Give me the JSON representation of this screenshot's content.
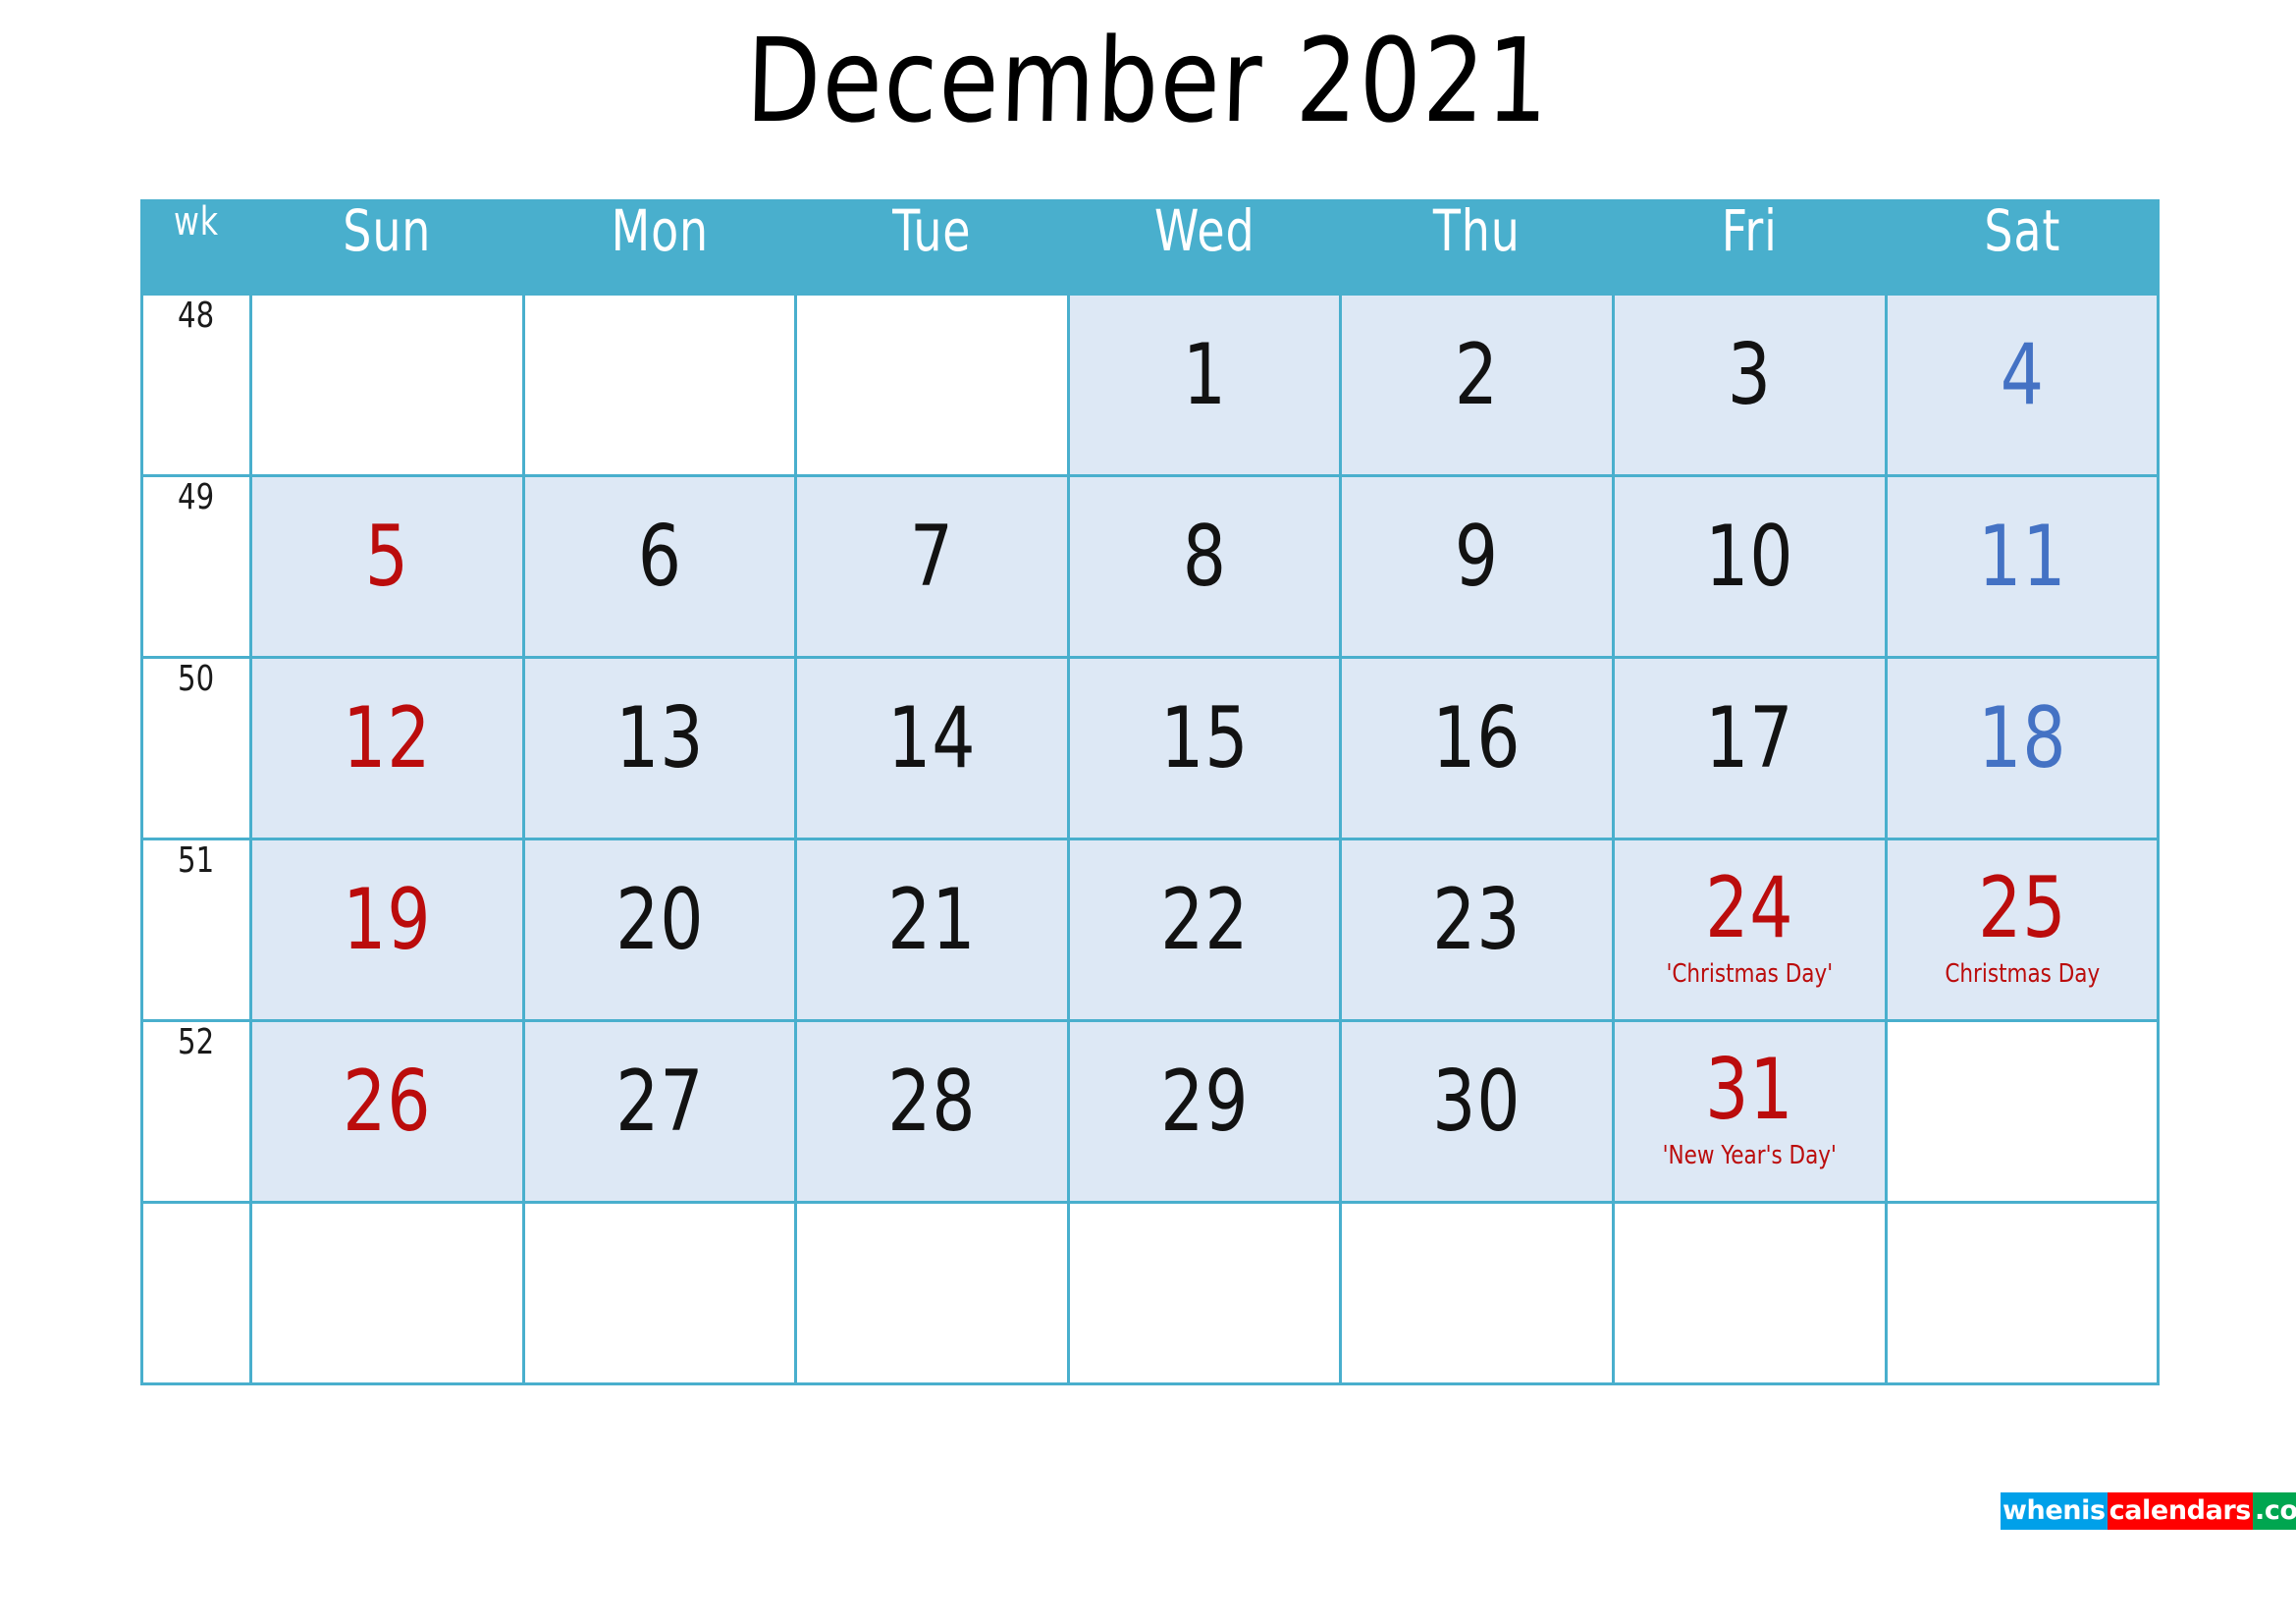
{
  "title": "December 2021",
  "header": {
    "week_label": "wk",
    "days": [
      "Sun",
      "Mon",
      "Tue",
      "Wed",
      "Thu",
      "Fri",
      "Sat"
    ]
  },
  "colors": {
    "header_bg": "#49afcd",
    "grid_line": "#49afcd",
    "cell_fill": "#dde8f5",
    "cell_empty": "#ffffff",
    "weekday_text": "#121212",
    "sunday_text": "#bb0c0c",
    "saturday_text": "#4472c4",
    "holiday_text": "#bb0c0c",
    "title_text": "#000000",
    "logo_blue": "#00a0e9",
    "logo_red": "#ff0000",
    "logo_green": "#00a650"
  },
  "weeks": [
    {
      "wk": "48",
      "days": [
        {
          "num": "",
          "filled": false,
          "style": "none",
          "event": ""
        },
        {
          "num": "",
          "filled": false,
          "style": "none",
          "event": ""
        },
        {
          "num": "",
          "filled": false,
          "style": "none",
          "event": ""
        },
        {
          "num": "1",
          "filled": true,
          "style": "weekday",
          "event": ""
        },
        {
          "num": "2",
          "filled": true,
          "style": "weekday",
          "event": ""
        },
        {
          "num": "3",
          "filled": true,
          "style": "weekday",
          "event": ""
        },
        {
          "num": "4",
          "filled": true,
          "style": "sat",
          "event": ""
        }
      ]
    },
    {
      "wk": "49",
      "days": [
        {
          "num": "5",
          "filled": true,
          "style": "sun",
          "event": ""
        },
        {
          "num": "6",
          "filled": true,
          "style": "weekday",
          "event": ""
        },
        {
          "num": "7",
          "filled": true,
          "style": "weekday",
          "event": ""
        },
        {
          "num": "8",
          "filled": true,
          "style": "weekday",
          "event": ""
        },
        {
          "num": "9",
          "filled": true,
          "style": "weekday",
          "event": ""
        },
        {
          "num": "10",
          "filled": true,
          "style": "weekday",
          "event": ""
        },
        {
          "num": "11",
          "filled": true,
          "style": "sat",
          "event": ""
        }
      ]
    },
    {
      "wk": "50",
      "days": [
        {
          "num": "12",
          "filled": true,
          "style": "sun",
          "event": ""
        },
        {
          "num": "13",
          "filled": true,
          "style": "weekday",
          "event": ""
        },
        {
          "num": "14",
          "filled": true,
          "style": "weekday",
          "event": ""
        },
        {
          "num": "15",
          "filled": true,
          "style": "weekday",
          "event": ""
        },
        {
          "num": "16",
          "filled": true,
          "style": "weekday",
          "event": ""
        },
        {
          "num": "17",
          "filled": true,
          "style": "weekday",
          "event": ""
        },
        {
          "num": "18",
          "filled": true,
          "style": "sat",
          "event": ""
        }
      ]
    },
    {
      "wk": "51",
      "days": [
        {
          "num": "19",
          "filled": true,
          "style": "sun",
          "event": ""
        },
        {
          "num": "20",
          "filled": true,
          "style": "weekday",
          "event": ""
        },
        {
          "num": "21",
          "filled": true,
          "style": "weekday",
          "event": ""
        },
        {
          "num": "22",
          "filled": true,
          "style": "weekday",
          "event": ""
        },
        {
          "num": "23",
          "filled": true,
          "style": "weekday",
          "event": ""
        },
        {
          "num": "24",
          "filled": true,
          "style": "holiday",
          "event": "'Christmas Day'"
        },
        {
          "num": "25",
          "filled": true,
          "style": "holiday",
          "event": "Christmas Day"
        }
      ]
    },
    {
      "wk": "52",
      "days": [
        {
          "num": "26",
          "filled": true,
          "style": "sun",
          "event": ""
        },
        {
          "num": "27",
          "filled": true,
          "style": "weekday",
          "event": ""
        },
        {
          "num": "28",
          "filled": true,
          "style": "weekday",
          "event": ""
        },
        {
          "num": "29",
          "filled": true,
          "style": "weekday",
          "event": ""
        },
        {
          "num": "30",
          "filled": true,
          "style": "weekday",
          "event": ""
        },
        {
          "num": "31",
          "filled": true,
          "style": "holiday",
          "event": "'New Year's Day'"
        },
        {
          "num": "",
          "filled": false,
          "style": "none",
          "event": ""
        }
      ]
    },
    {
      "wk": "",
      "days": [
        {
          "num": "",
          "filled": false,
          "style": "none",
          "event": ""
        },
        {
          "num": "",
          "filled": false,
          "style": "none",
          "event": ""
        },
        {
          "num": "",
          "filled": false,
          "style": "none",
          "event": ""
        },
        {
          "num": "",
          "filled": false,
          "style": "none",
          "event": ""
        },
        {
          "num": "",
          "filled": false,
          "style": "none",
          "event": ""
        },
        {
          "num": "",
          "filled": false,
          "style": "none",
          "event": ""
        },
        {
          "num": "",
          "filled": false,
          "style": "none",
          "event": ""
        }
      ]
    }
  ],
  "logo": {
    "part1": "whenis",
    "part2": "calendars",
    "part3": ".com"
  }
}
